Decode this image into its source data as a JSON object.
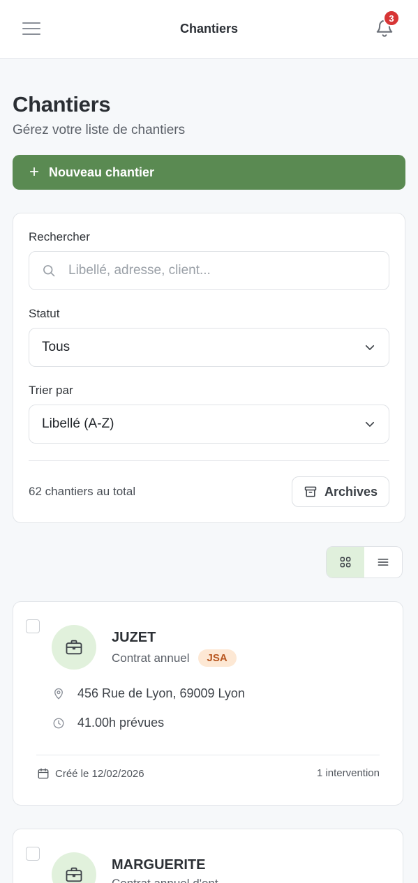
{
  "header": {
    "title": "Chantiers",
    "notification_count": "3"
  },
  "page": {
    "title": "Chantiers",
    "subtitle": "Gérez votre liste de chantiers"
  },
  "new_button": {
    "plus": "+",
    "label": "Nouveau chantier"
  },
  "filters": {
    "search_label": "Rechercher",
    "search_placeholder": "Libellé, adresse, client...",
    "status_label": "Statut",
    "status_value": "Tous",
    "sort_label": "Trier par",
    "sort_value": "Libellé (A-Z)",
    "total_text": "62 chantiers au total",
    "archives_label": "Archives"
  },
  "cards": [
    {
      "name": "JUZET",
      "contract": "Contrat annuel",
      "tag": "JSA",
      "address": "456 Rue de Lyon, 69009 Lyon",
      "hours": "41.00h prévues",
      "created": "Créé le 12/02/2026",
      "interventions": "1 intervention"
    },
    {
      "name": "MARGUERITE",
      "contract": "Contrat annuel d'ent..."
    }
  ],
  "colors": {
    "primary_green": "#5a8a52",
    "badge_red": "#d73535",
    "tag_bg": "#fde8d4",
    "tag_text": "#b8561f"
  }
}
